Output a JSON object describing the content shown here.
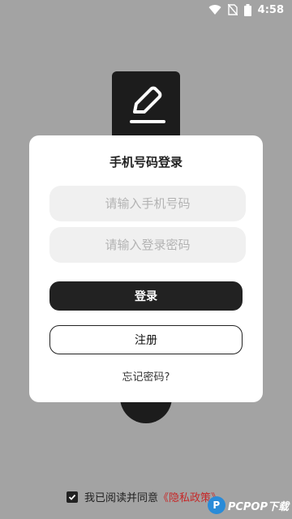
{
  "status_bar": {
    "time": "4:58",
    "icons": [
      "wifi-icon",
      "no-sim-icon",
      "battery-icon"
    ]
  },
  "dialog": {
    "title": "手机号码登录",
    "phone_placeholder": "请输入手机号码",
    "password_placeholder": "请输入登录密码",
    "login_label": "登录",
    "register_label": "注册",
    "forgot_label": "忘记密码?"
  },
  "agreement": {
    "prefix": "我已阅读并同意",
    "policy_link": "《隐私政策》",
    "checked": true
  },
  "watermark": {
    "logo": "P",
    "text": "PCPOP下载"
  },
  "colors": {
    "backdrop": "#a3a3a3",
    "primary": "#222222",
    "link": "#c62828",
    "field_bg": "#f0f0f0"
  }
}
